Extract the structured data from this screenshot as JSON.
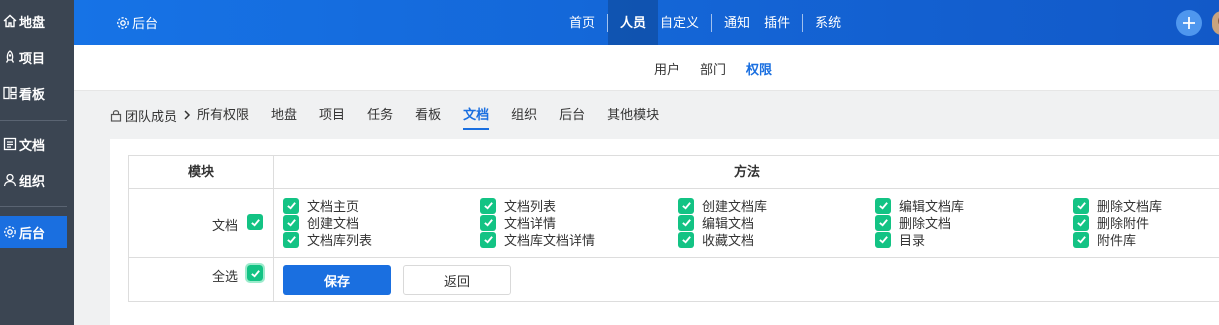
{
  "sidebar": {
    "items": [
      {
        "label": "地盘",
        "icon": "home-icon"
      },
      {
        "label": "项目",
        "icon": "rocket-icon"
      },
      {
        "label": "看板",
        "icon": "kanban-icon"
      },
      {
        "label": "文档",
        "icon": "document-icon"
      },
      {
        "label": "组织",
        "icon": "user-icon"
      },
      {
        "label": "后台",
        "icon": "gear-icon"
      }
    ],
    "active": "后台"
  },
  "topbar": {
    "admin_label": "后台",
    "nav": [
      "首页",
      "人员",
      "自定义",
      "通知",
      "插件",
      "系统"
    ],
    "active_nav": "人员"
  },
  "subnav": {
    "items": [
      "用户",
      "部门",
      "权限"
    ],
    "active": "权限"
  },
  "breadcrumb": {
    "root": "团队成员",
    "tabs": [
      "所有权限",
      "地盘",
      "项目",
      "任务",
      "看板",
      "文档",
      "组织",
      "后台",
      "其他模块"
    ],
    "active_tab": "文档"
  },
  "table": {
    "header_module": "模块",
    "header_method": "方法",
    "module_name": "文档",
    "select_all": "全选",
    "permissions": [
      [
        "文档主页",
        "文档列表",
        "创建文档库",
        "编辑文档库",
        "删除文档库"
      ],
      [
        "创建文档",
        "文档详情",
        "编辑文档",
        "删除文档",
        "删除附件"
      ],
      [
        "文档库列表",
        "文档库文档详情",
        "收藏文档",
        "目录",
        "附件库"
      ]
    ],
    "save_label": "保存",
    "back_label": "返回"
  },
  "colors": {
    "accent": "#1a6fe0",
    "checkbox": "#13c384",
    "sidebar_bg": "#3b4552"
  }
}
